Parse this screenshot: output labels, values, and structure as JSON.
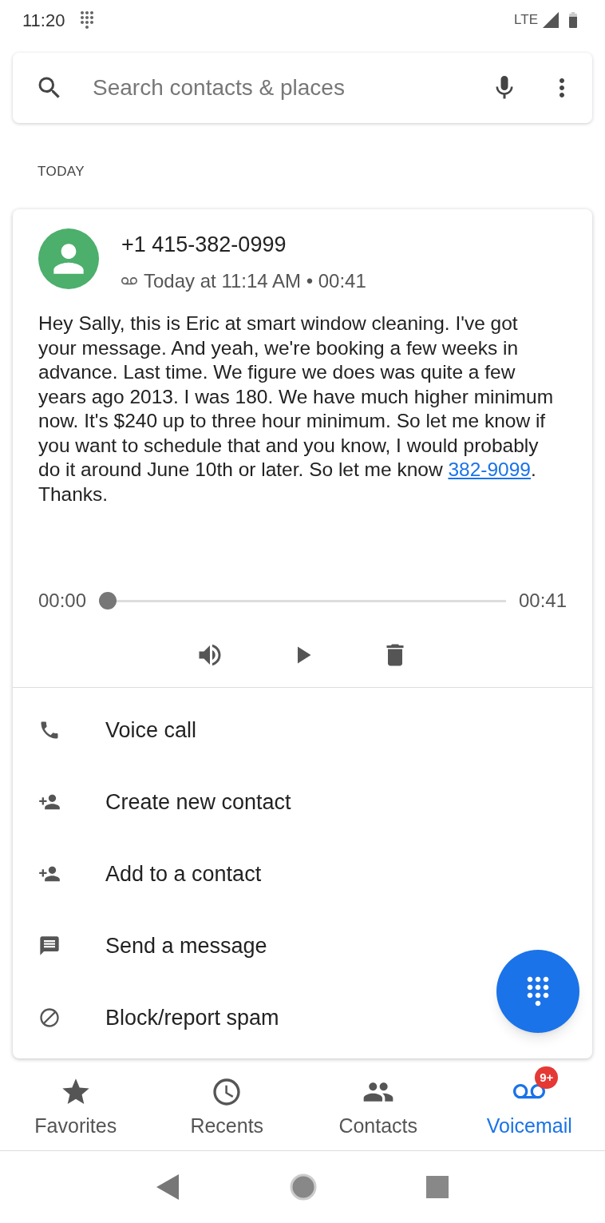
{
  "status_bar": {
    "time": "11:20",
    "network": "LTE"
  },
  "search": {
    "placeholder": "Search contacts & places"
  },
  "section_header": "TODAY",
  "voicemail": {
    "number": "+1 415-382-0999",
    "meta": "Today at 11:14 AM • 00:41",
    "transcript_before": "Hey Sally, this is Eric at smart window cleaning. I've got your message. And yeah, we're booking a few weeks in advance. Last time. We figure we does was quite a few years ago 2013. I was 180. We have much higher minimum now. It's $240 up to three hour minimum. So let me know if you want to schedule that and you know, I would probably do it around June 10th or later. So let me know ",
    "transcript_link": "382-9099",
    "transcript_after": ". Thanks.",
    "player": {
      "elapsed": "00:00",
      "duration": "00:41",
      "level": 0
    }
  },
  "actions": [
    {
      "kind": "call",
      "label": "Voice call"
    },
    {
      "kind": "add-person",
      "label": "Create new contact"
    },
    {
      "kind": "add-person",
      "label": "Add to a contact"
    },
    {
      "kind": "message",
      "label": "Send a message"
    },
    {
      "kind": "block",
      "label": "Block/report spam"
    }
  ],
  "tabs": [
    {
      "kind": "favorites",
      "label": "Favorites",
      "selected": false
    },
    {
      "kind": "recents",
      "label": "Recents",
      "selected": false
    },
    {
      "kind": "contacts",
      "label": "Contacts",
      "selected": false
    },
    {
      "kind": "voicemail",
      "label": "Voicemail",
      "selected": true,
      "badge": "9+"
    }
  ]
}
